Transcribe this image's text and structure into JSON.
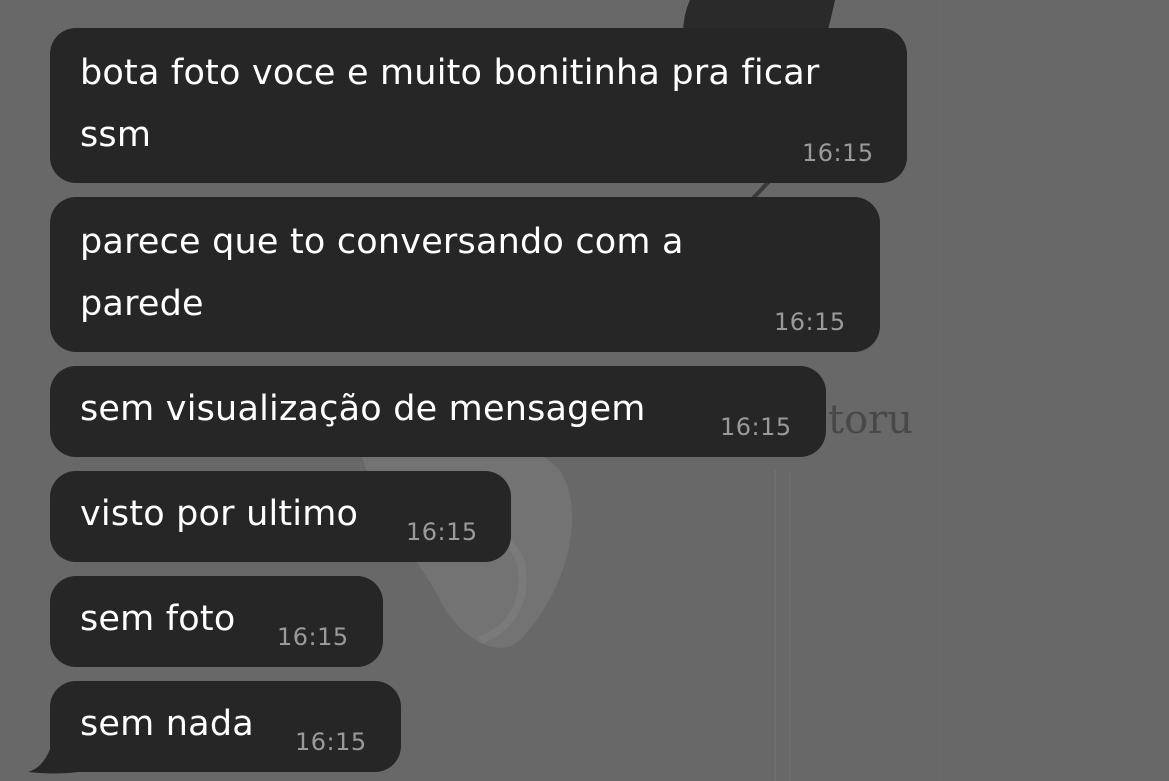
{
  "wallpaper": {
    "watermark_text": "toru"
  },
  "messages": [
    {
      "text": "bota foto voce e muito bonitinha pra ficar\nssm",
      "time": "16:15"
    },
    {
      "text": "parece que to conversando com a\nparede",
      "time": "16:15"
    },
    {
      "text": "sem visualização de mensagem",
      "time": "16:15"
    },
    {
      "text": "visto por ultimo",
      "time": "16:15"
    },
    {
      "text": "sem foto",
      "time": "16:15"
    },
    {
      "text": "sem nada",
      "time": "16:15"
    }
  ],
  "colors": {
    "background": "#686868",
    "bubble": "#262626",
    "message_text": "#ffffff",
    "timestamp": "#9a9a9a"
  }
}
